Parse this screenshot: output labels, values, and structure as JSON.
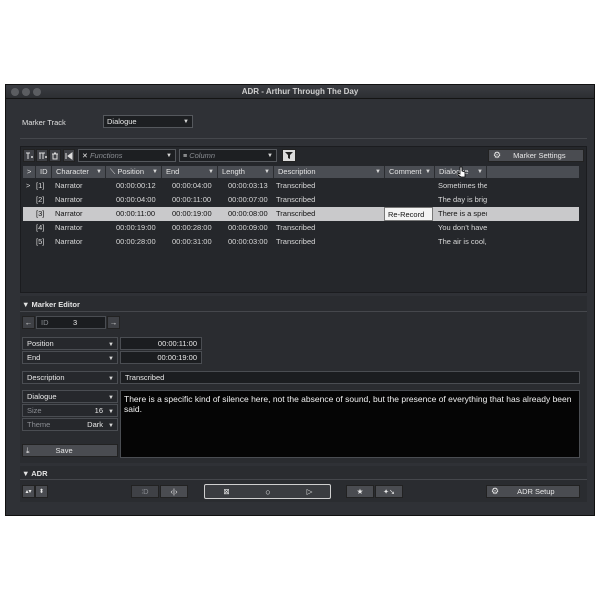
{
  "window": {
    "title": "ADR - Arthur Through The Day"
  },
  "marker_track": {
    "label": "Marker Track",
    "value": "Dialogue"
  },
  "toolbar": {
    "functions_placeholder": "Functions",
    "column_placeholder": "Column",
    "marker_settings_label": "Marker Settings"
  },
  "table": {
    "headers": {
      "arrow": ">",
      "id": "ID",
      "character": "Character",
      "position": "Position",
      "end": "End",
      "length": "Length",
      "description": "Description",
      "comment": "Comment",
      "dialogue": "Dialogue"
    },
    "rows": [
      {
        "arrow": ">",
        "id": "[1]",
        "character": "Narrator",
        "position": "00:00:00:12",
        "end": "00:00:04:00",
        "length": "00:00:03:13",
        "description": "Transcribed",
        "comment": "",
        "dialogue": "Sometimes the"
      },
      {
        "arrow": "",
        "id": "[2]",
        "character": "Narrator",
        "position": "00:00:04:00",
        "end": "00:00:11:00",
        "length": "00:00:07:00",
        "description": "Transcribed",
        "comment": "",
        "dialogue": "The day is brigl"
      },
      {
        "arrow": "",
        "id": "[3]",
        "character": "Narrator",
        "position": "00:00:11:00",
        "end": "00:00:19:00",
        "length": "00:00:08:00",
        "description": "Transcribed",
        "comment": "Re-Record",
        "dialogue": "There is a spec"
      },
      {
        "arrow": "",
        "id": "[4]",
        "character": "Narrator",
        "position": "00:00:19:00",
        "end": "00:00:28:00",
        "length": "00:00:09:00",
        "description": "Transcribed",
        "comment": "",
        "dialogue": "You don’t have"
      },
      {
        "arrow": "",
        "id": "[5]",
        "character": "Narrator",
        "position": "00:00:28:00",
        "end": "00:00:31:00",
        "length": "00:00:03:00",
        "description": "Transcribed",
        "comment": "",
        "dialogue": "The air is cool,"
      }
    ]
  },
  "marker_editor": {
    "title": "Marker Editor",
    "id_label": "ID",
    "id_value": "3",
    "position_label": "Position",
    "position_value": "00:00:11:00",
    "end_label": "End",
    "end_value": "00:00:19:00",
    "description_label": "Description",
    "description_value": "Transcribed",
    "dialogue_label": "Dialogue",
    "size_label": "Size",
    "size_value": "16",
    "theme_label": "Theme",
    "theme_value": "Dark",
    "save_label": "Save",
    "text": "There is a specific kind of silence here, not the absence of sound, but the presence of everything that has already been said."
  },
  "adr": {
    "title": "ADR",
    "setup_label": "ADR Setup"
  }
}
